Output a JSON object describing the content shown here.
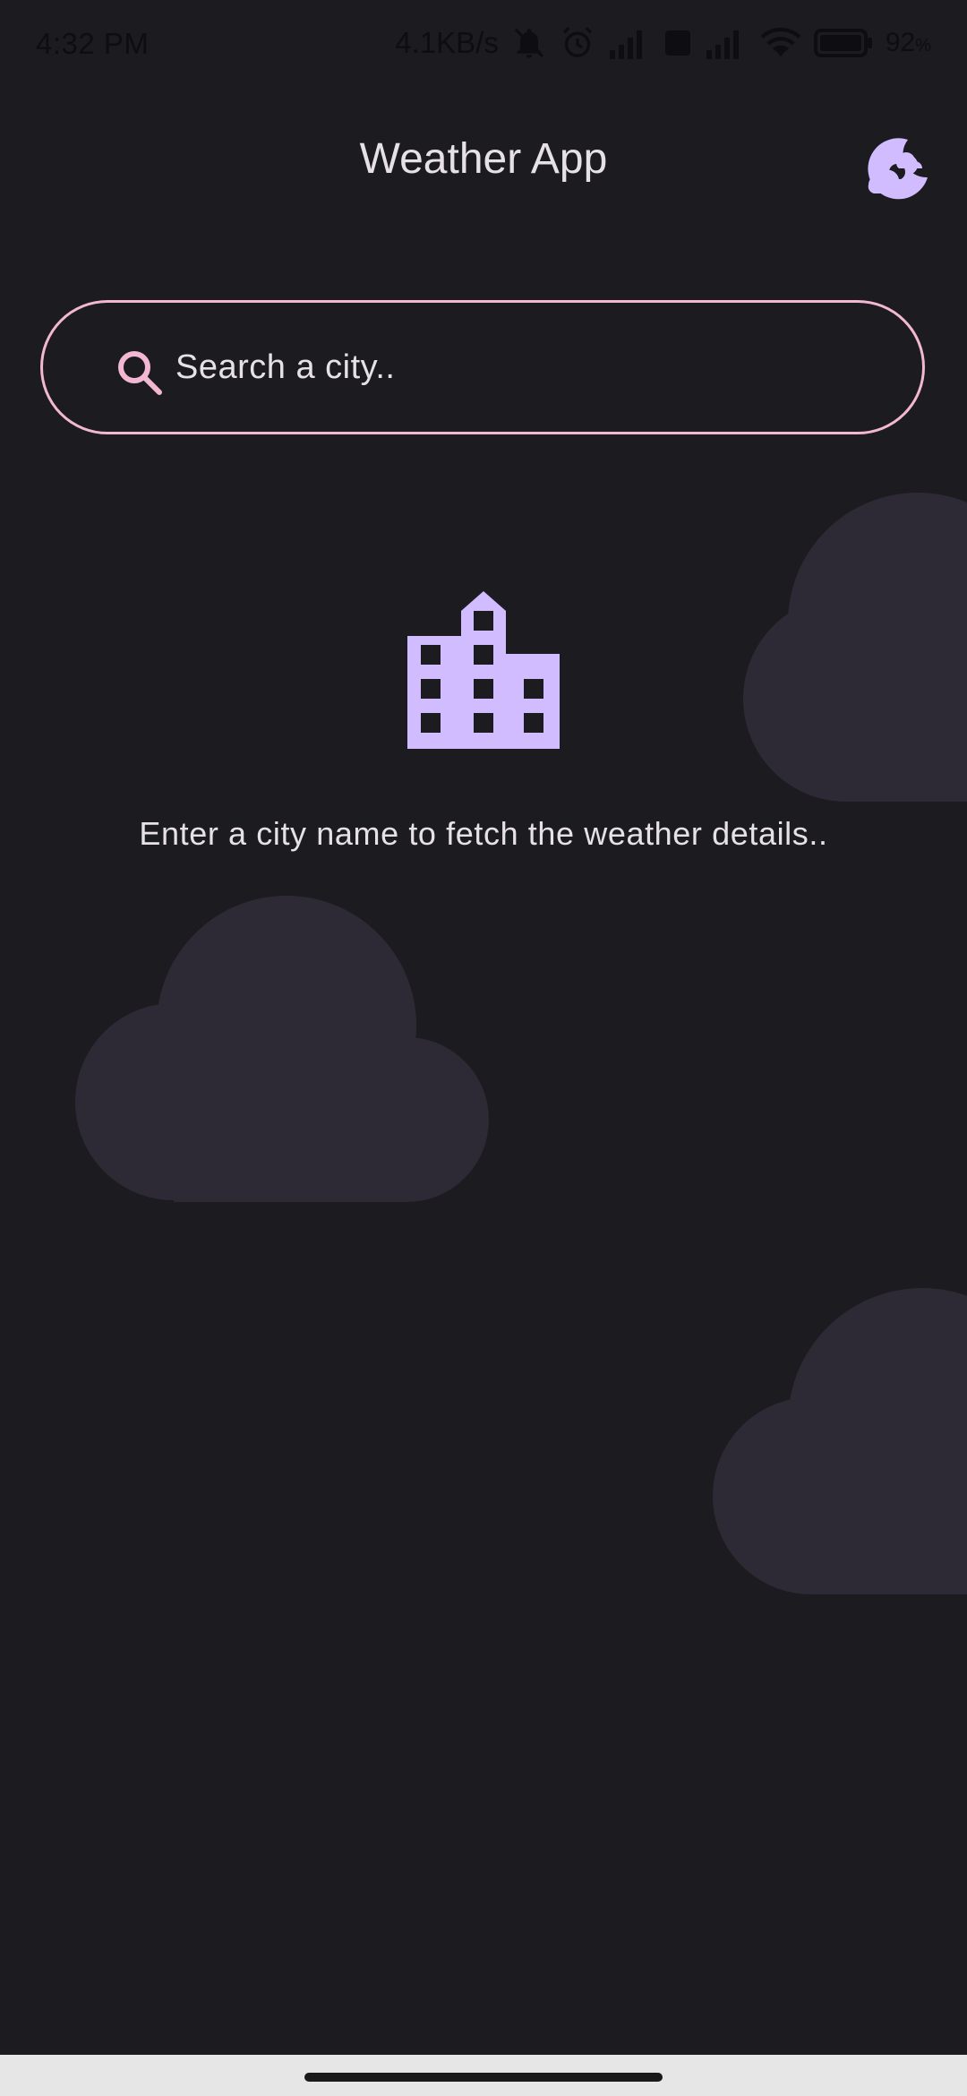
{
  "status_bar": {
    "time": "4:32 PM",
    "network_speed": "4.1KB/s",
    "battery_percent": "92",
    "battery_unit": "%"
  },
  "app_bar": {
    "title": "Weather App",
    "theme_toggle_icon": "dark-mode-icon"
  },
  "search": {
    "placeholder": "Search a city..",
    "value": "",
    "icon": "search-icon"
  },
  "empty_state": {
    "icon": "location-city-icon",
    "message": "Enter a city name to fetch the weather details.."
  },
  "colors": {
    "background": "#1c1b1f",
    "accent": "#d0bcff",
    "search_border": "#f2b8d3",
    "cloud": "#2d2a35",
    "text": "#e6e1e5"
  }
}
